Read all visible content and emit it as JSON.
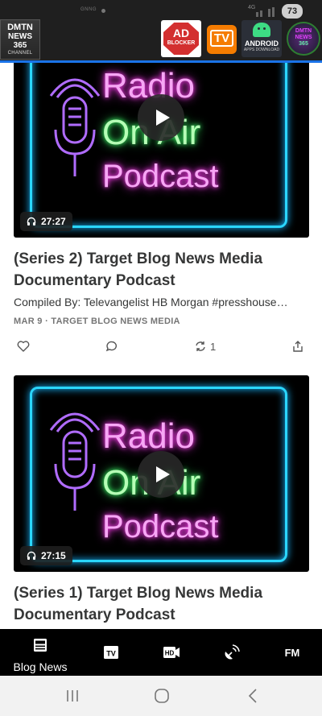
{
  "status_bar": {
    "left_text": "GNNG",
    "network": "4G",
    "battery": "73"
  },
  "header": {
    "logo": {
      "line1": "DMTN",
      "line2": "NEWS",
      "line3": "365",
      "line4": "CHANNEL"
    },
    "adblock": {
      "line1": "AD",
      "line2": "BLOCKER"
    },
    "tv_app": {
      "label": "TV"
    },
    "android_app": {
      "line1": "ANDROID",
      "line2": "APPS DOWNLOAD"
    },
    "dmtn_round": {
      "line1": "DMTN",
      "line2": "NEWS",
      "line3": "365"
    }
  },
  "posts": [
    {
      "thumb_lines": [
        "Radio",
        "On Air",
        "Podcast"
      ],
      "duration": "27:27",
      "title": "(Series 2) Target Blog News Media Documentary Podcast",
      "subtitle": "Compiled By: Televangelist HB Morgan #presshouse…",
      "meta": "MAR 9 · TARGET BLOG NEWS MEDIA",
      "restack_count": "1"
    },
    {
      "thumb_lines": [
        "Radio",
        "On Air",
        "Podcast"
      ],
      "duration": "27:15",
      "title": "(Series 1) Target Blog News Media Documentary Podcast"
    }
  ],
  "bottom_nav": {
    "items": [
      {
        "label": "Blog News",
        "icon": "news-icon"
      },
      {
        "label": "",
        "icon": "tv-icon"
      },
      {
        "label": "",
        "icon": "hd-video-icon"
      },
      {
        "label": "",
        "icon": "satellite-dish-icon"
      },
      {
        "label": "",
        "icon": "fm-radio-icon"
      }
    ]
  },
  "colors": {
    "header_bg": "#1f1f1f",
    "accent_blue": "#1a73e8",
    "text_dark": "#363737",
    "text_meta": "#757575",
    "neon_pink": "#ff3cf0",
    "neon_green": "#3cff6a",
    "neon_blue": "#2ad6ff"
  }
}
